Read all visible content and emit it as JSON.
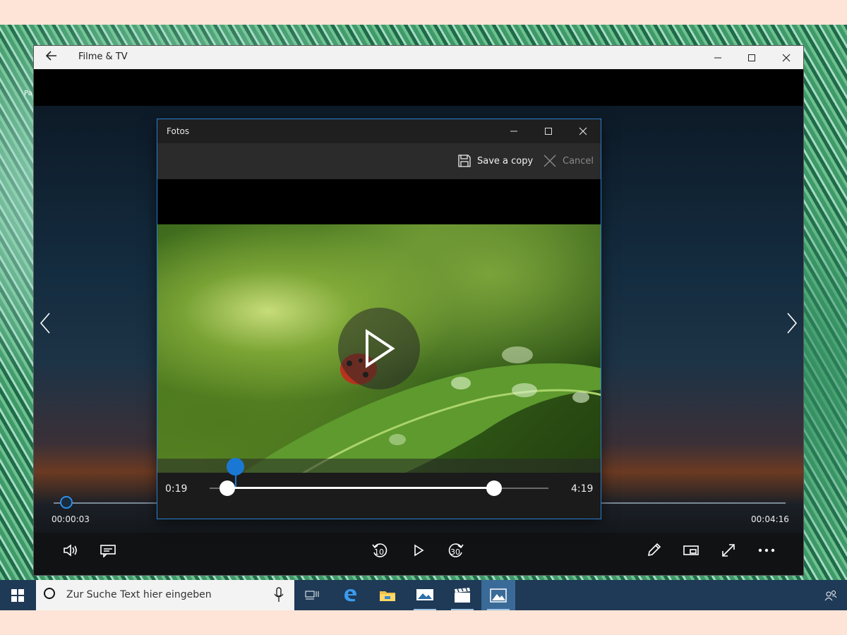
{
  "desktop": {
    "recycle_label": "Pa"
  },
  "filme": {
    "title": "Filme & TV",
    "back_icon": "back-arrow-icon",
    "elapsed": "00:00:03",
    "total": "00:04:16",
    "progress_fraction": 0.02,
    "skip_back_label": "10",
    "skip_forward_label": "30"
  },
  "fotos": {
    "title": "Fotos",
    "save_copy_label": "Save a copy",
    "cancel_label": "Cancel",
    "trim_start": "0:19",
    "trim_end": "4:19"
  },
  "taskbar": {
    "search_placeholder": "Zur Suche Text hier eingeben",
    "apps": [
      "task-view",
      "edge",
      "file-explorer",
      "photos-editor",
      "filme-tv",
      "fotos"
    ]
  },
  "colors": {
    "accent": "#1a78d4",
    "taskbar": "#1e3a56"
  }
}
